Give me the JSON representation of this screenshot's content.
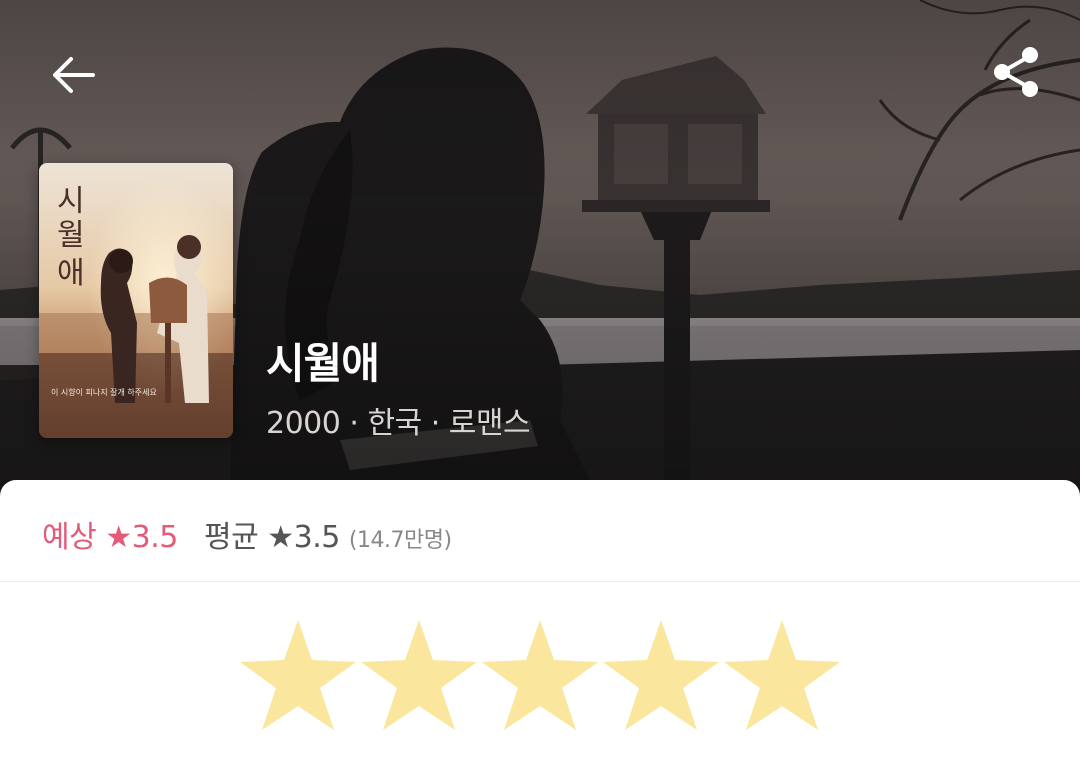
{
  "header": {
    "back_icon": "arrow-left-icon",
    "share_icon": "share-icon"
  },
  "movie": {
    "title": "시월애",
    "meta": "2000 · 한국 · 로맨스",
    "poster": {
      "title_text": "시월애",
      "tagline": "이 시향이 피나지 잘개 하주세요"
    }
  },
  "ratings": {
    "expected_label": "예상",
    "expected_value": "3.5",
    "average_label": "평균",
    "average_value": "3.5",
    "count": "(14.7만명)",
    "star_glyph": "★"
  },
  "user_rating": {
    "max_stars": 5,
    "star_color": "#fae69c"
  },
  "colors": {
    "accent_pink": "#e35b79",
    "text_gray": "#555555"
  }
}
